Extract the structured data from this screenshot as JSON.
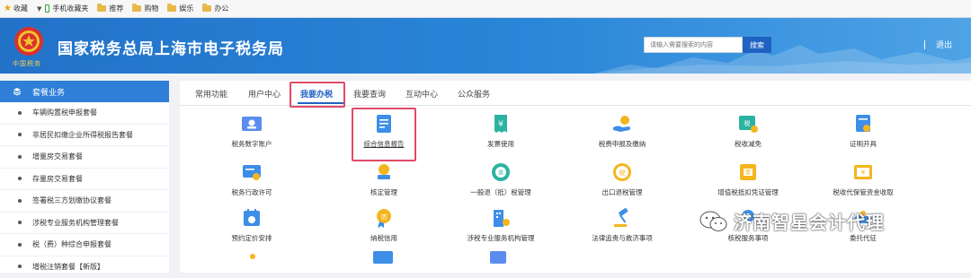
{
  "bookmarks": {
    "favorites": "收藏",
    "items": [
      "手机收藏夹",
      "推荐",
      "购物",
      "娱乐",
      "办公"
    ]
  },
  "header": {
    "title": "国家税务总局上海市电子税务局",
    "emblem_sub": "中国税务",
    "search_placeholder": "请输入需要搜索的内容",
    "search_button": "搜索",
    "separator": "|",
    "logout": "退出"
  },
  "sidebar": {
    "title": "套餐业务",
    "items": [
      "车辆购置税申报套餐",
      "非居民扣缴企业所得税报告套餐",
      "增量房交易套餐",
      "存量房交易套餐",
      "签署税三方划缴协议套餐",
      "涉税专业服务机构管理套餐",
      "税（费）种综合申报套餐",
      "增税注销套餐【新版】"
    ]
  },
  "tabs": [
    "常用功能",
    "用户中心",
    "我要办税",
    "我要查询",
    "互动中心",
    "公众服务"
  ],
  "active_tab": "我要办税",
  "tiles": [
    "税务数字账户",
    "综合信息报告",
    "发票使用",
    "税费申报及缴纳",
    "税收减免",
    "证明开具",
    "税务行政许可",
    "核定管理",
    "一般退（抵）税管理",
    "出口退税管理",
    "增值税抵扣凭证管理",
    "税收代保管资金收取",
    "预约定价安排",
    "纳税信用",
    "涉税专业服务机构管理",
    "法律追责与救济事项",
    "核税服务事项",
    "委托代征"
  ],
  "watermark": "济南智星会计代理",
  "colors": {
    "header_blue": "#2a86d8",
    "sidebar_blue": "#2f7fd8",
    "active_tab": "#1f62c2",
    "highlight": "#e04a68"
  }
}
